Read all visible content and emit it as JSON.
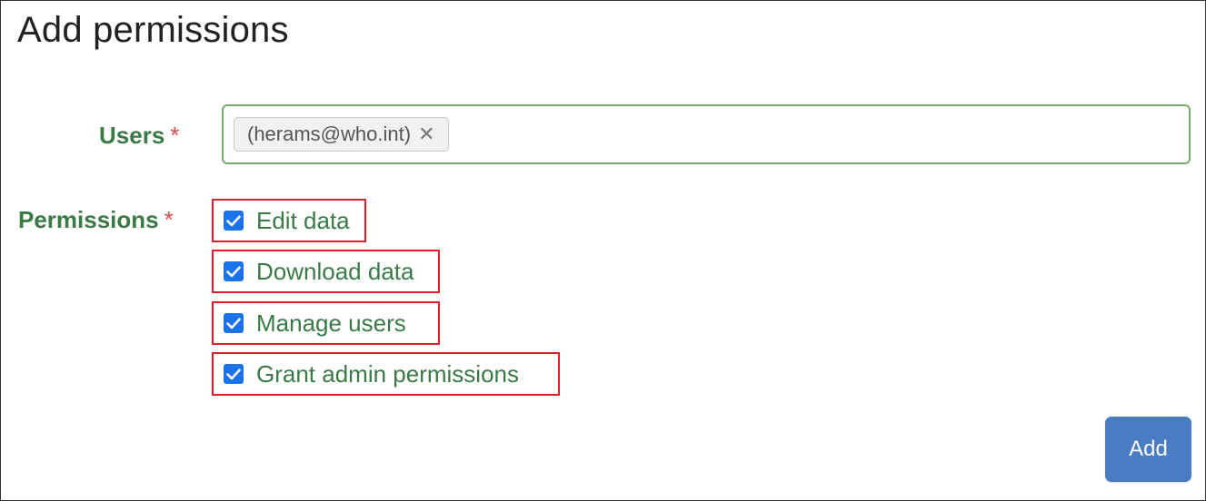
{
  "page": {
    "title": "Add permissions"
  },
  "users_field": {
    "label": "Users",
    "required_marker": "*",
    "selected": [
      {
        "text": "(herams@who.int)",
        "remove_symbol": "✕"
      }
    ]
  },
  "permissions_field": {
    "label": "Permissions",
    "required_marker": "*",
    "options": [
      {
        "label": "Edit data",
        "checked": true
      },
      {
        "label": "Download data",
        "checked": true
      },
      {
        "label": "Manage users",
        "checked": true
      },
      {
        "label": "Grant admin permissions",
        "checked": true
      }
    ]
  },
  "actions": {
    "add_label": "Add"
  },
  "colors": {
    "label_green": "#3a7a46",
    "required_red": "#e04848",
    "highlight_red": "#e0202a",
    "checkbox_blue": "#1a73e8",
    "button_blue": "#4a7cc4"
  },
  "icons": {
    "checkbox": "check-icon",
    "tag_remove": "close-icon"
  }
}
